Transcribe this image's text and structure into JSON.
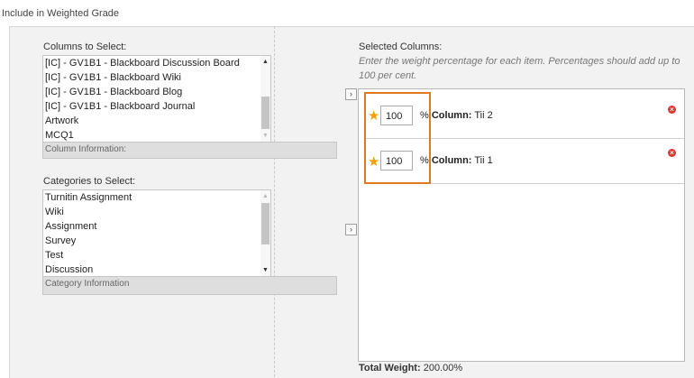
{
  "header": {
    "title": "Include in Weighted Grade"
  },
  "columns_select": {
    "label": "Columns to Select:",
    "items": [
      "[IC] - GV1B1 - Blackboard Discussion Board",
      "[IC] - GV1B1 - Blackboard Wiki",
      "[IC] - GV1B1 - Blackboard Blog",
      "[IC] - GV1B1 - Blackboard Journal",
      "Artwork",
      "MCQ1"
    ],
    "info": "Column Information:"
  },
  "categories_select": {
    "label": "Categories to Select:",
    "items": [
      "Turnitin Assignment",
      "Wiki",
      "Assignment",
      "Survey",
      "Test",
      "Discussion"
    ],
    "info": "Category Information"
  },
  "selected": {
    "label": "Selected Columns:",
    "instructions": "Enter the weight percentage for each item. Percentages should add up to 100 per cent.",
    "rows": [
      {
        "weight": "100",
        "percent": "%",
        "col_label": "Column:",
        "col_name": "Tii 2"
      },
      {
        "weight": "100",
        "percent": "%",
        "col_label": "Column:",
        "col_name": "Tii 1"
      }
    ],
    "total_label": "Total Weight:",
    "total_value": "200.00%"
  },
  "colors": {
    "highlight": "#e07a1f",
    "required_star": "#f0a000",
    "remove": "#e0342c"
  },
  "icons": {
    "move": "chevron-right-icon",
    "remove": "remove-icon",
    "required": "required-star-icon"
  }
}
